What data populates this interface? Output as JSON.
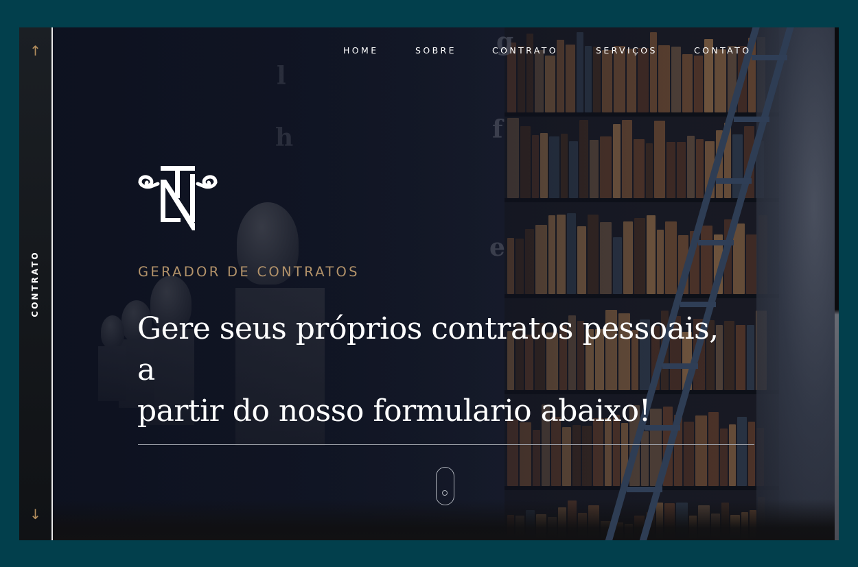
{
  "rail": {
    "up_arrow": "↑",
    "down_arrow": "↓",
    "label": "CONTRATO"
  },
  "nav": {
    "items": [
      {
        "label": "HOME"
      },
      {
        "label": "SOBRE"
      },
      {
        "label": "CONTRATO"
      },
      {
        "label": "SERVIÇOS"
      },
      {
        "label": "CONTATO"
      }
    ]
  },
  "hero": {
    "logo_icon": "nt-monogram-logo",
    "subtitle": "GERADOR DE CONTRATOS",
    "headline_line1": "Gere seus próprios contratos pessoais, a",
    "headline_line2": "partir do nosso formulario abaixo!",
    "scroll_icon": "mouse-scroll-icon"
  },
  "colors": {
    "page_border": "#023f4c",
    "accent_gold": "#b3936a",
    "text_white": "#ffffff"
  }
}
